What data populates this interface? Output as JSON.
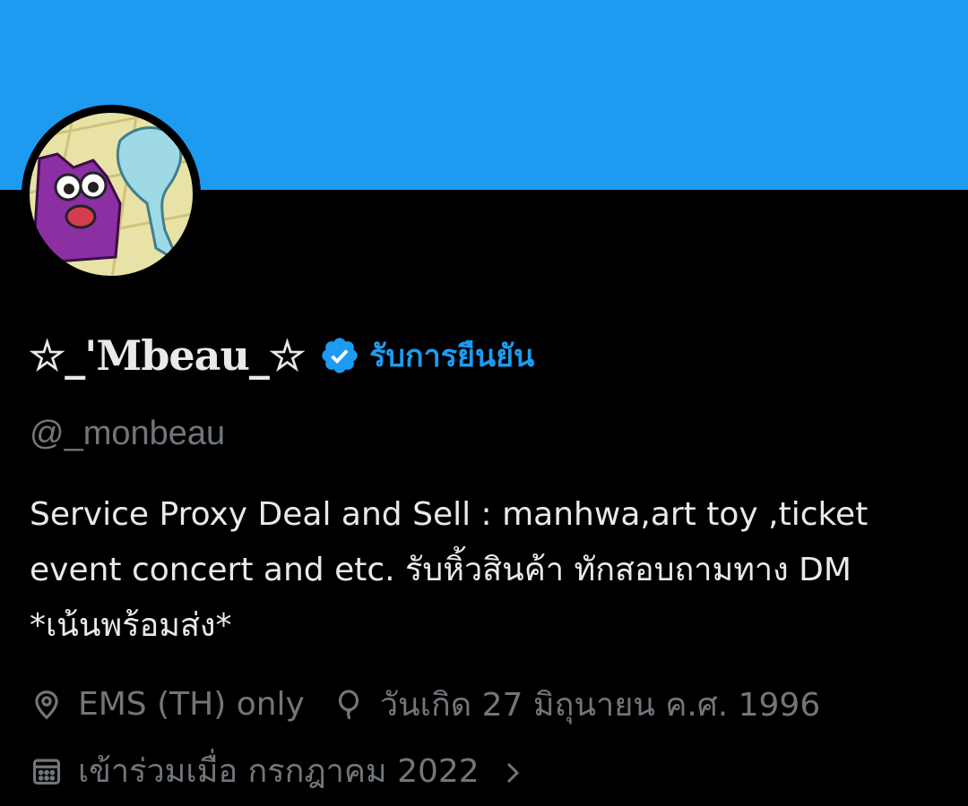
{
  "banner": {
    "color": "#1d9bf0"
  },
  "profile": {
    "display_name": "☆_'Mbeau_☆",
    "verified_icon": "verified-badge-icon",
    "verified_label": "รับการยืนยัน",
    "handle": "@_monbeau",
    "bio": "Service Proxy  Deal and Sell : manhwa,art toy ,ticket\nevent concert and etc. รับหิ้วสินค้า ทักสอบถามทาง DM\n*เน้นพร้อมส่ง*",
    "location": "EMS (TH) only",
    "birthday": "วันเกิด 27 มิถุนายน ค.ศ. 1996",
    "joined": "เข้าร่วมเมื่อ กรกฎาคม 2022"
  },
  "icons": {
    "location": "location-pin-icon",
    "birthday": "balloon-icon",
    "joined": "calendar-icon",
    "more": "chevron-right-icon"
  },
  "colors": {
    "accent": "#1d9bf0",
    "muted": "#71767b",
    "text": "#e7e9ea",
    "background": "#000000"
  }
}
